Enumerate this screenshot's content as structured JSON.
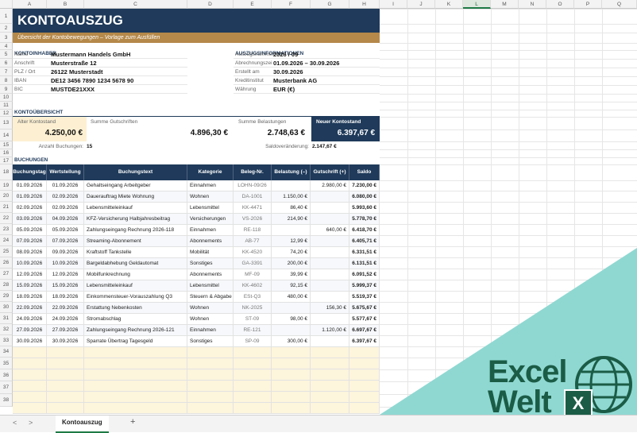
{
  "sheet": {
    "columns": [
      "A",
      "B",
      "C",
      "D",
      "E",
      "F",
      "G",
      "H",
      "I",
      "J",
      "K",
      "L",
      "M",
      "N",
      "O",
      "P",
      "Q"
    ],
    "selected_column": "L",
    "rows": [
      "1",
      "2",
      "3",
      "4",
      "5",
      "6",
      "7",
      "8",
      "9",
      "10",
      "11",
      "12",
      "13",
      "14",
      "15",
      "16",
      "17",
      "18",
      "19",
      "20",
      "21",
      "22",
      "23",
      "24",
      "25",
      "26",
      "27",
      "28",
      "29",
      "30",
      "31",
      "32",
      "33",
      "34",
      "35",
      "36",
      "37",
      "38"
    ]
  },
  "title": "KONTOAUSZUG",
  "subtitle": "Übersicht der Kontobewegungen – Vorlage zum Ausfüllen",
  "holder": {
    "heading": "KONTOINHABER",
    "fields": [
      {
        "label": "Name",
        "value": "Mustermann Handels GmbH"
      },
      {
        "label": "Anschrift",
        "value": "Musterstraße 12"
      },
      {
        "label": "PLZ / Ort",
        "value": "26122 Musterstadt"
      },
      {
        "label": "IBAN",
        "value": "DE12 3456 7890 1234 5678 90"
      },
      {
        "label": "BIC",
        "value": "MUSTDE21XXX"
      }
    ]
  },
  "statement": {
    "heading": "AUSZUGSINFORMATIONEN",
    "fields": [
      {
        "label": "Auszugsnummer",
        "value": "2026 / 09"
      },
      {
        "label": "Abrechnungszei",
        "value": "01.09.2026 – 30.09.2026"
      },
      {
        "label": "Erstellt am",
        "value": "30.09.2026"
      },
      {
        "label": "Kreditinstitut",
        "value": "Musterbank AG"
      },
      {
        "label": "Währung",
        "value": "EUR (€)"
      }
    ]
  },
  "overview": {
    "heading": "KONTOÜBERSICHT",
    "old_label": "Alter Kontostand",
    "old_value": "4.250,00 €",
    "credits_label": "Summe Gutschriften",
    "credits_value": "4.896,30 €",
    "debits_label": "Summe Belastungen",
    "debits_value": "2.748,63 €",
    "new_label": "Neuer Kontostand",
    "new_value": "6.397,67 €",
    "count_label": "Anzahl Buchungen:",
    "count_value": "15",
    "change_label": "Saldoveränderung:",
    "change_value": "2.147,67 €"
  },
  "bookings": {
    "heading": "BUCHUNGEN",
    "headers": [
      "Buchungstag",
      "Wertstellung",
      "Buchungstext",
      "Kategorie",
      "Beleg-Nr.",
      "Belastung (–)",
      "Gutschrift (+)",
      "Saldo"
    ],
    "rows": [
      [
        "01.09.2026",
        "01.09.2026",
        "Gehaltseingang Arbeitgeber",
        "Einnahmen",
        "LOHN-09/26",
        "",
        "2.980,00 €",
        "7.230,00 €"
      ],
      [
        "01.09.2026",
        "02.09.2026",
        "Dauerauftrag Miete Wohnung",
        "Wohnen",
        "DA-1001",
        "1.150,00 €",
        "",
        "6.080,00 €"
      ],
      [
        "02.09.2026",
        "02.09.2026",
        "Lebensmitteleinkauf",
        "Lebensmittel",
        "KK-4471",
        "86,40 €",
        "",
        "5.993,60 €"
      ],
      [
        "03.09.2026",
        "04.09.2026",
        "KFZ-Versicherung Halbjahresbeitrag",
        "Versicherungen",
        "VS-2026",
        "214,90 €",
        "",
        "5.778,70 €"
      ],
      [
        "05.09.2026",
        "05.09.2026",
        "Zahlungseingang Rechnung 2026-118",
        "Einnahmen",
        "RE-118",
        "",
        "640,00 €",
        "6.418,70 €"
      ],
      [
        "07.09.2026",
        "07.09.2026",
        "Streaming-Abonnement",
        "Abonnements",
        "AB-77",
        "12,99 €",
        "",
        "6.405,71 €"
      ],
      [
        "08.09.2026",
        "09.09.2026",
        "Kraftstoff Tankstelle",
        "Mobilität",
        "KK-4520",
        "74,20 €",
        "",
        "6.331,51 €"
      ],
      [
        "10.09.2026",
        "10.09.2026",
        "Bargeldabhebung Geldautomat",
        "Sonstiges",
        "GA-3391",
        "200,00 €",
        "",
        "6.131,51 €"
      ],
      [
        "12.09.2026",
        "12.09.2026",
        "Mobilfunkrechnung",
        "Abonnements",
        "MF-09",
        "39,99 €",
        "",
        "6.091,52 €"
      ],
      [
        "15.09.2026",
        "15.09.2026",
        "Lebensmitteleinkauf",
        "Lebensmittel",
        "KK-4602",
        "92,15 €",
        "",
        "5.999,37 €"
      ],
      [
        "18.09.2026",
        "18.09.2026",
        "Einkommensteuer-Vorauszahlung Q3",
        "Steuern & Abgabe",
        "ESt-Q3",
        "480,00 €",
        "",
        "5.519,37 €"
      ],
      [
        "22.09.2026",
        "22.09.2026",
        "Erstattung Nebenkosten",
        "Wohnen",
        "NK-2025",
        "",
        "156,30 €",
        "5.675,67 €"
      ],
      [
        "24.09.2026",
        "24.09.2026",
        "Stromabschlag",
        "Wohnen",
        "ST-09",
        "98,00 €",
        "",
        "5.577,67 €"
      ],
      [
        "27.09.2026",
        "27.09.2026",
        "Zahlungseingang Rechnung 2026-121",
        "Einnahmen",
        "RE-121",
        "",
        "1.120,00 €",
        "6.697,67 €"
      ],
      [
        "30.09.2026",
        "30.09.2026",
        "Sparrate Übertrag Tagesgeld",
        "Sonstiges",
        "SP-09",
        "300,00 €",
        "",
        "6.397,67 €"
      ]
    ]
  },
  "tabs": {
    "prev": "<",
    "next": ">",
    "active": "Kontoauszug",
    "add": "+"
  },
  "logo": {
    "line1": "Excel",
    "line2": "Welt",
    "badge": "X"
  },
  "colors": {
    "navy": "#1f3a5a",
    "gold": "#b5894a",
    "teal": "#8fd8d2",
    "logo": "#1b5c46"
  }
}
